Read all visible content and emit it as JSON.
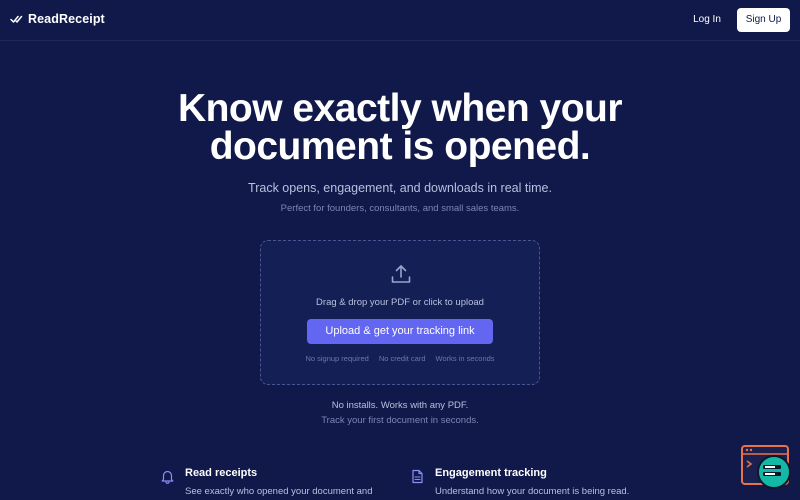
{
  "nav": {
    "brand": "ReadReceipt",
    "login_label": "Log In",
    "signup_label": "Sign Up"
  },
  "hero": {
    "title_line1": "Know exactly when your",
    "title_line2": "document is opened.",
    "subtitle": "Track opens, engagement, and downloads in real time.",
    "note": "Perfect for founders, consultants, and small sales teams."
  },
  "upload": {
    "prompt": "Drag & drop your PDF or click to upload",
    "button_label": "Upload & get your tracking link",
    "badges": [
      "No signup required",
      "No credit card",
      "Works in seconds"
    ]
  },
  "after_upload": {
    "line1": "No installs. Works with any PDF.",
    "line2": "Track your first document in seconds."
  },
  "features": [
    {
      "title": "Read receipts",
      "description": "See exactly who opened your document and",
      "icon": "bell-icon"
    },
    {
      "title": "Engagement tracking",
      "description": "Understand how your document is being read.",
      "icon": "document-icon"
    }
  ],
  "colors": {
    "background": "#10194a",
    "accent": "#6366f1",
    "text_muted": "#b8c0dd",
    "widget_orange": "#e8734a",
    "widget_teal": "#14b8a6"
  }
}
